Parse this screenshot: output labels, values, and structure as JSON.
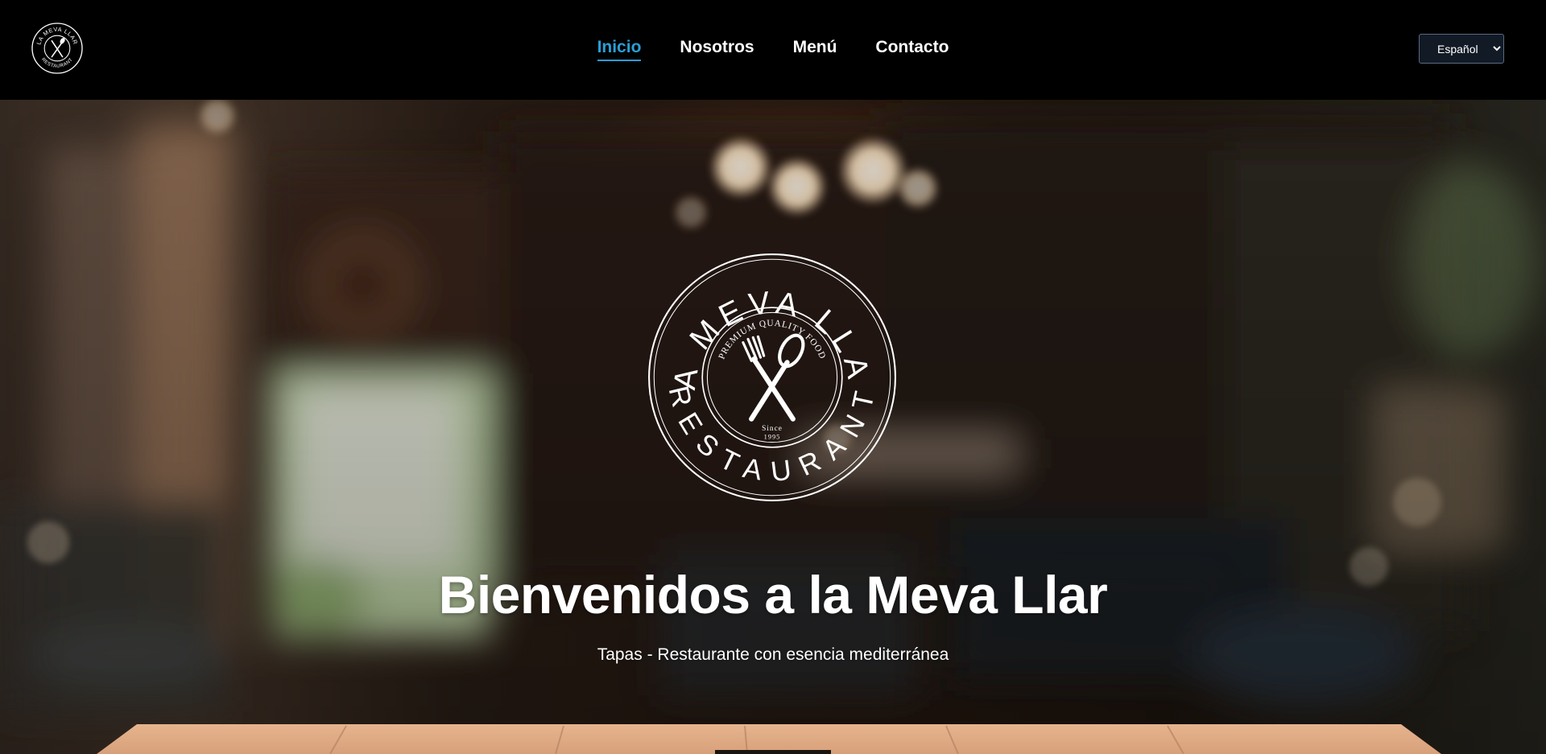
{
  "header": {
    "logo_icon": "restaurant-seal-logo",
    "nav": [
      {
        "label": "Inicio",
        "active": true
      },
      {
        "label": "Nosotros",
        "active": false
      },
      {
        "label": "Menú",
        "active": false
      },
      {
        "label": "Contacto",
        "active": false
      }
    ],
    "language": {
      "selected": "Español"
    }
  },
  "hero": {
    "logo": {
      "arc_text": "LA MEVA LLAR",
      "bottom_text": "RESTAURANT",
      "tagline": "PREMIUM QUALITY FOOD",
      "since_label": "Since",
      "since_year": "1995"
    },
    "title": "Bienvenidos a la Meva Llar",
    "subtitle": "Tapas - Restaurante con esencia mediterránea"
  },
  "colors": {
    "header_bg": "#000000",
    "active_link": "#2a9fd6",
    "text": "#ffffff"
  }
}
